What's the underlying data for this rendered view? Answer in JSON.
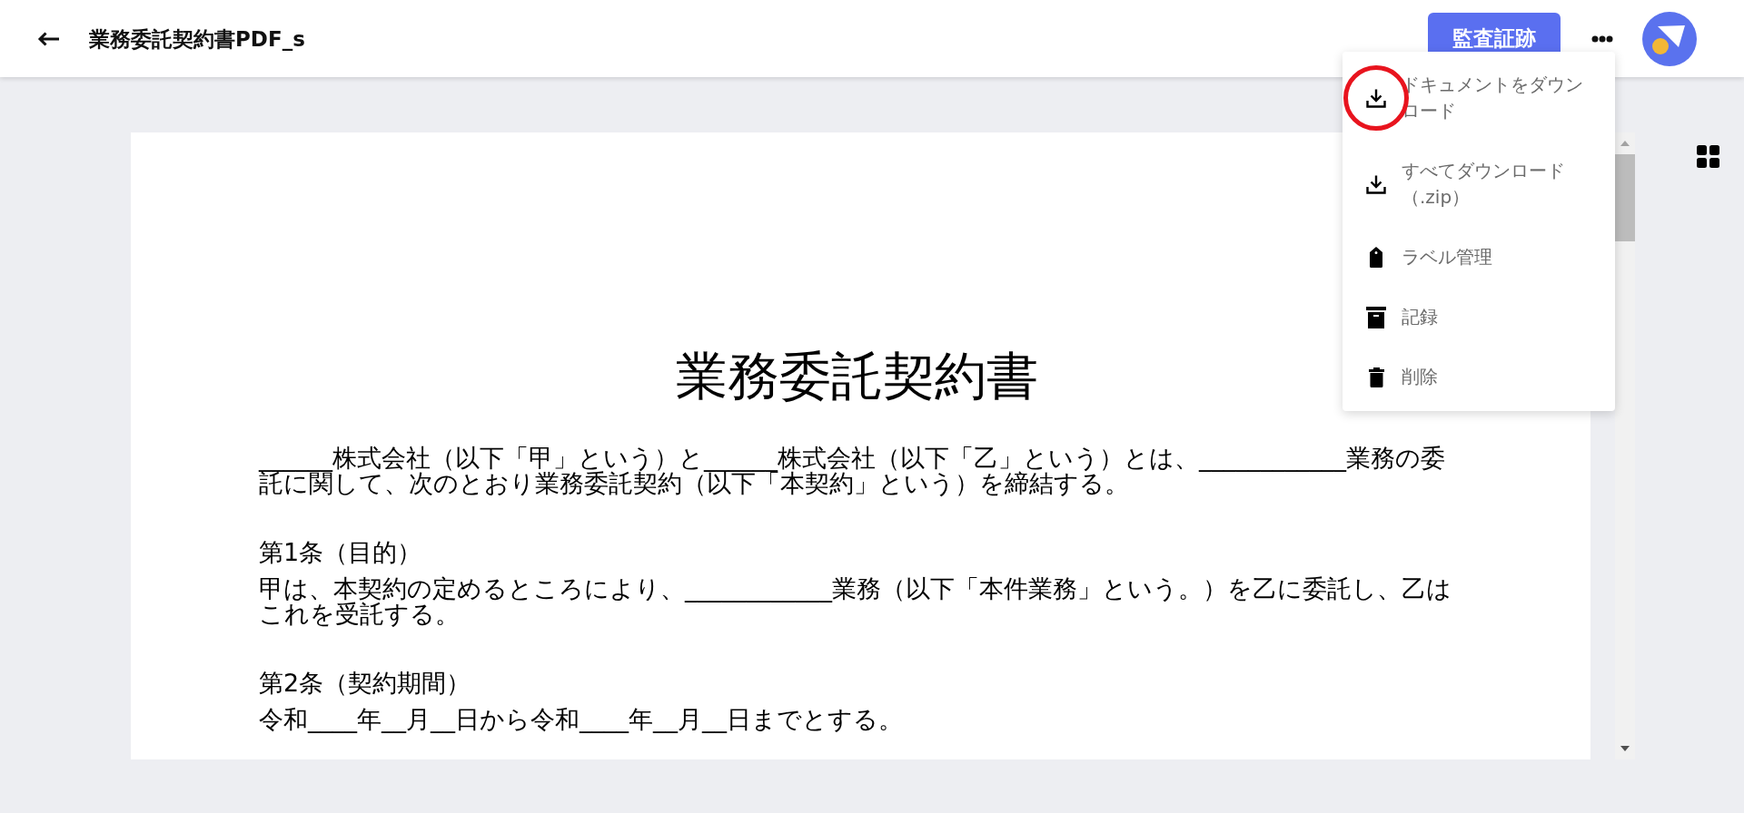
{
  "header": {
    "title": "業務委託契約書PDF_s",
    "audit_button": "監査証跡"
  },
  "document": {
    "title": "業務委託契約書",
    "blocks": [
      {
        "kind": "paragraph",
        "text": "______株式会社（以下「甲」という）と______株式会社（以下「乙」という）とは、____________業務の委託に関して、次のとおり業務委託契約（以下「本契約」という）を締結する。"
      },
      {
        "kind": "heading",
        "text": "第1条（目的）"
      },
      {
        "kind": "paragraph",
        "text": "甲は、本契約の定めるところにより、____________業務（以下「本件業務」という。）を乙に委託し、乙はこれを受託する。"
      },
      {
        "kind": "heading",
        "text": "第2条（契約期間）"
      },
      {
        "kind": "paragraph",
        "text": "令和____年__月__日から令和____年__月__日までとする。"
      }
    ]
  },
  "menu": {
    "items": [
      {
        "kind": "download",
        "label": "ドキュメントをダウンロード",
        "highlighted": true
      },
      {
        "kind": "download",
        "label": "すべてダウンロード（.zip）",
        "highlighted": false
      },
      {
        "kind": "label",
        "label": "ラベル管理",
        "highlighted": false
      },
      {
        "kind": "archive",
        "label": "記録",
        "highlighted": false
      },
      {
        "kind": "delete",
        "label": "削除",
        "highlighted": false
      }
    ]
  }
}
